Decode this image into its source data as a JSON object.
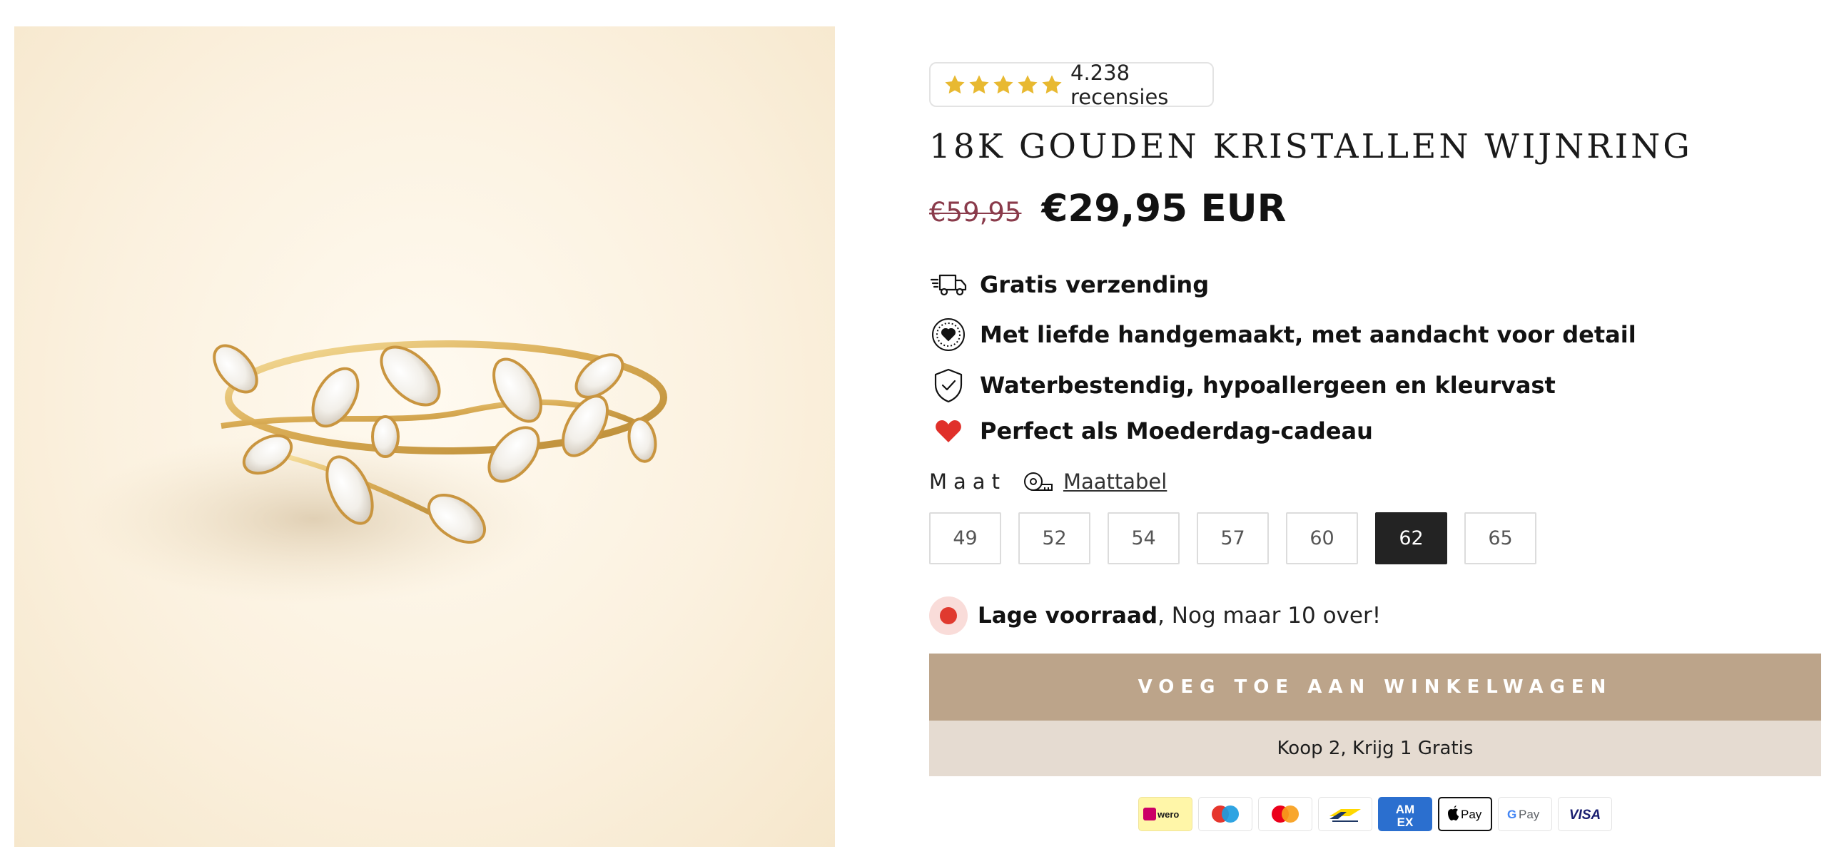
{
  "product": {
    "rating_text": "4.238 recensies",
    "stars": 5,
    "title": "18K GOUDEN KRISTALLEN WIJNRING",
    "compare_price": "€59,95",
    "price": "€29,95 EUR"
  },
  "features": [
    {
      "icon": "delivery-truck-icon",
      "text": "Gratis verzending"
    },
    {
      "icon": "handmade-heart-badge-icon",
      "text": "Met liefde handgemaakt, met aandacht voor detail"
    },
    {
      "icon": "shield-check-icon",
      "text": "Waterbestendig, hypoallergeen en kleurvast"
    },
    {
      "icon": "heart-icon",
      "text": "Perfect als Moederdag-cadeau"
    }
  ],
  "size": {
    "label": "Maat",
    "chart_link": "Maattabel",
    "options": [
      "49",
      "52",
      "54",
      "57",
      "60",
      "62",
      "65"
    ],
    "selected": "62"
  },
  "stock": {
    "strong": "Lage voorraad",
    "rest": ", Nog maar 10 over!"
  },
  "buttons": {
    "add_to_cart": "VOEG TOE AAN WINKELWAGEN",
    "promo": "Koop 2, Krijg 1 Gratis"
  },
  "payments": [
    {
      "name": "wero",
      "label": "wero"
    },
    {
      "name": "maestro",
      "label": ""
    },
    {
      "name": "mastercard",
      "label": ""
    },
    {
      "name": "bancontact",
      "label": ""
    },
    {
      "name": "amex",
      "label": "AM EX"
    },
    {
      "name": "apple-pay",
      "label": "Pay"
    },
    {
      "name": "google-pay",
      "label": "G Pay"
    },
    {
      "name": "visa",
      "label": "VISA"
    }
  ],
  "colors": {
    "accent_button": "#bca48a",
    "promo_bar": "#e5dbd1",
    "compare_price": "#8a3b4b",
    "star": "#e8b931",
    "stock_dot": "#e03a2f",
    "selected_size": "#232323"
  }
}
